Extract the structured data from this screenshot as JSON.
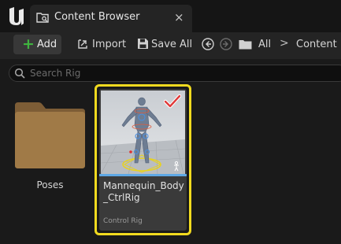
{
  "tab": {
    "title": "Content Browser",
    "close": "×"
  },
  "toolbar": {
    "add_label": "Add",
    "import_label": "Import",
    "save_all_label": "Save All"
  },
  "breadcrumb": {
    "root": "All",
    "separator": ">",
    "current": "Content"
  },
  "search": {
    "placeholder": "Search Rig",
    "value": ""
  },
  "items": [
    {
      "name": "Poses",
      "kind": "folder",
      "icon": "folder-icon"
    },
    {
      "name": "Mannequin_Body_CtrlRig",
      "type_label": "Control Rig",
      "selected": true,
      "icon": "control-rig-thumbnail"
    }
  ],
  "colors": {
    "accent_add": "#3fb43f",
    "selection_border": "#f1da1f",
    "asset_stripe": "#5ea8e5",
    "checkmark": "#e03a3a",
    "folder": "#a07a47"
  }
}
